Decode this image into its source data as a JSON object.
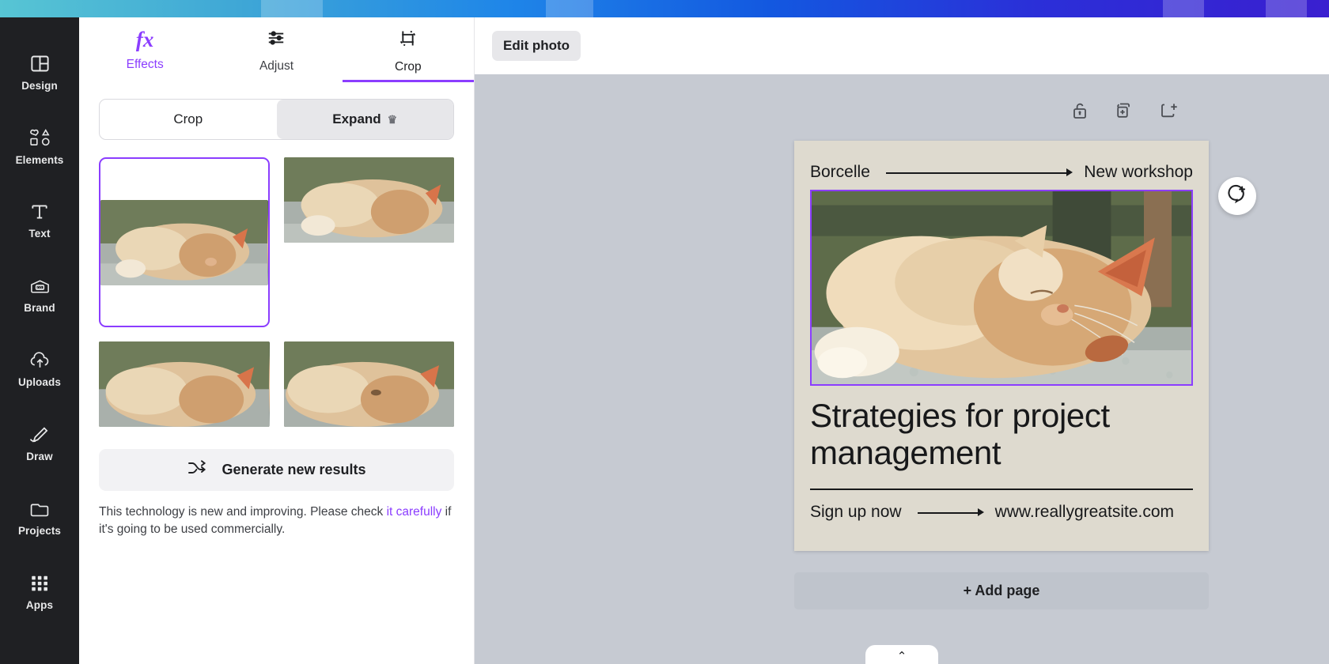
{
  "app": {
    "accent_purple": "#8b3dff",
    "rail_bg": "#1f2023",
    "canvas_bg": "#c6cad2"
  },
  "sidebar": {
    "items": [
      {
        "label": "Design",
        "icon": "layout-icon"
      },
      {
        "label": "Elements",
        "icon": "shapes-icon"
      },
      {
        "label": "Text",
        "icon": "text-t-icon"
      },
      {
        "label": "Brand",
        "icon": "brand-card-icon"
      },
      {
        "label": "Uploads",
        "icon": "cloud-upload-icon"
      },
      {
        "label": "Draw",
        "icon": "pen-draw-icon"
      },
      {
        "label": "Projects",
        "icon": "folder-icon"
      },
      {
        "label": "Apps",
        "icon": "grid-apps-icon"
      }
    ]
  },
  "panel": {
    "tabs": [
      {
        "label": "Effects",
        "icon": "fx-icon",
        "active": false
      },
      {
        "label": "Adjust",
        "icon": "sliders-icon",
        "active": false
      },
      {
        "label": "Crop",
        "icon": "crop-rotate-icon",
        "active": true
      }
    ],
    "segmented": {
      "crop_label": "Crop",
      "expand_label": "Expand",
      "expand_badge": "crown-icon",
      "selected": "Expand"
    },
    "results": [
      {
        "name": "result-1",
        "selected": true
      },
      {
        "name": "result-2",
        "selected": false
      },
      {
        "name": "result-3",
        "selected": false
      },
      {
        "name": "result-4",
        "selected": false
      }
    ],
    "generate_label": "Generate new results",
    "generate_icon": "shuffle-icon",
    "disclaimer_before": "This technology is new and improving. Please check ",
    "disclaimer_link": "it carefully",
    "disclaimer_after": " if it's going to be used commercially."
  },
  "editor": {
    "edit_photo_label": "Edit photo",
    "float_icons": [
      {
        "name": "unlock-icon"
      },
      {
        "name": "duplicate-page-icon"
      },
      {
        "name": "add-page-icon"
      }
    ],
    "comment_icon": "add-comment-icon",
    "add_page_label": "+ Add page",
    "bottom_chevron": "chevron-up-icon"
  },
  "design_page": {
    "brand": "Borcelle",
    "header_right": "New workshop",
    "title": "Strategies for project management",
    "footer_left": "Sign up now",
    "footer_right": "www.reallygreatsite.com",
    "page_bg": "#dedacf",
    "selection_color": "#8b3dff"
  }
}
